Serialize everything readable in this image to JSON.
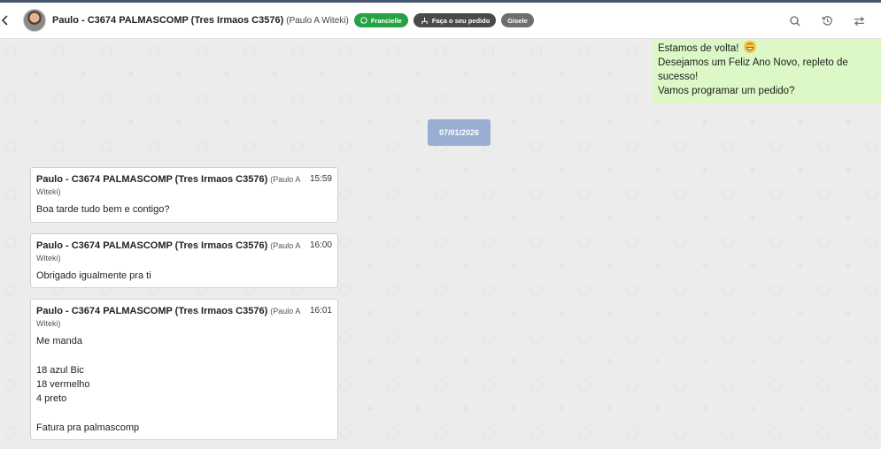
{
  "header": {
    "contact_name": "Paulo - C3674 PALMASCOMP (Tres Irmaos C3576)",
    "contact_alias": "(Paulo A Witeki)",
    "tags": [
      {
        "label": "Francielle",
        "color": "#25a244",
        "icon": "whatsapp-icon"
      },
      {
        "label": "Faça o seu pedido",
        "color": "#4a4a4a",
        "icon": "hierarchy-icon"
      },
      {
        "label": "Gisele",
        "color": "#6e6e6e"
      }
    ],
    "actions": [
      "search-icon",
      "history-icon",
      "transfer-icon"
    ]
  },
  "outgoing_message": {
    "line1": "Estamos de volta!",
    "line2": "Desejamos um Feliz Ano Novo, repleto de sucesso!",
    "line3": "Vamos programar um pedido?",
    "emoji": "grinning-face"
  },
  "date_divider": "07/01/2026",
  "messages": [
    {
      "sender": "Paulo - C3674 PALMASCOMP (Tres Irmaos C3576)",
      "alias": "(Paulo A Witeki)",
      "time": "15:59",
      "text": "Boa tarde tudo bem e contigo?"
    },
    {
      "sender": "Paulo - C3674 PALMASCOMP (Tres Irmaos C3576)",
      "alias": "(Paulo A Witeki)",
      "time": "16:00",
      "text": "Obrigado igualmente pra ti"
    },
    {
      "sender": "Paulo - C3674 PALMASCOMP (Tres Irmaos C3576)",
      "alias": "(Paulo A Witeki)",
      "time": "16:01",
      "text": "Me manda\n\n18 azul Bic\n18 vermelho\n4 preto\n\nFatura pra palmascomp"
    }
  ],
  "colors": {
    "outgoing_bubble": "#dcf8c6",
    "date_chip": "#9aaed3",
    "top_accent": "#4a5770"
  }
}
